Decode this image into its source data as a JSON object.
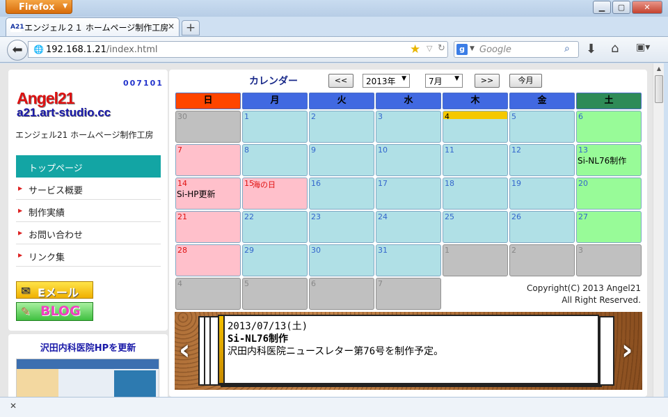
{
  "browser": {
    "app_button": "Firefox",
    "tab_title": "エンジェル２１ ホームページ制作工房",
    "tab_icon_text": "A21",
    "url_host": "192.168.1.21",
    "url_path": "/index.html",
    "search_placeholder": "Google",
    "search_engine_icon": "g-icon"
  },
  "sidebar": {
    "counter": "007101",
    "logo_line1": "Angel21",
    "logo_line2": "a21.art-studio.cc",
    "site_name": "エンジェル21 ホームページ制作工房",
    "menu": [
      {
        "label": "トップページ"
      },
      {
        "label": "サービス概要"
      },
      {
        "label": "制作実績"
      },
      {
        "label": "お問い合わせ"
      },
      {
        "label": "リンク集"
      }
    ],
    "email_label": "Eメール",
    "blog_label": "BLOG",
    "news_title": "沢田内科医院HPを更新"
  },
  "calendar": {
    "title": "カレンダー",
    "prev_label": "<<",
    "next_label": ">>",
    "year": "2013年",
    "month": "7月",
    "today_label": "今月",
    "weekdays": [
      "日",
      "月",
      "火",
      "水",
      "木",
      "金",
      "土"
    ],
    "weekday_colors": [
      "#ff4500",
      "#4169e1",
      "#4169e1",
      "#4169e1",
      "#4169e1",
      "#4169e1",
      "#2e8b57"
    ],
    "rows": [
      [
        {
          "d": "30",
          "t": "other"
        },
        {
          "d": "1",
          "t": "weekday"
        },
        {
          "d": "2",
          "t": "weekday"
        },
        {
          "d": "3",
          "t": "weekday"
        },
        {
          "d": "4",
          "t": "today"
        },
        {
          "d": "5",
          "t": "weekday"
        },
        {
          "d": "6",
          "t": "sat"
        }
      ],
      [
        {
          "d": "7",
          "t": "sun"
        },
        {
          "d": "8",
          "t": "weekday"
        },
        {
          "d": "9",
          "t": "weekday"
        },
        {
          "d": "10",
          "t": "weekday"
        },
        {
          "d": "11",
          "t": "weekday"
        },
        {
          "d": "12",
          "t": "weekday"
        },
        {
          "d": "13",
          "t": "sat",
          "ev": "Si-NL76制作"
        }
      ],
      [
        {
          "d": "14",
          "t": "sun",
          "ev": "Si-HP更新"
        },
        {
          "d": "15",
          "t": "sun",
          "hol": "海の日"
        },
        {
          "d": "16",
          "t": "weekday"
        },
        {
          "d": "17",
          "t": "weekday"
        },
        {
          "d": "18",
          "t": "weekday"
        },
        {
          "d": "19",
          "t": "weekday"
        },
        {
          "d": "20",
          "t": "sat"
        }
      ],
      [
        {
          "d": "21",
          "t": "sun"
        },
        {
          "d": "22",
          "t": "weekday"
        },
        {
          "d": "23",
          "t": "weekday"
        },
        {
          "d": "24",
          "t": "weekday"
        },
        {
          "d": "25",
          "t": "weekday"
        },
        {
          "d": "26",
          "t": "weekday"
        },
        {
          "d": "27",
          "t": "sat"
        }
      ],
      [
        {
          "d": "28",
          "t": "sun"
        },
        {
          "d": "29",
          "t": "weekday"
        },
        {
          "d": "30",
          "t": "weekday"
        },
        {
          "d": "31",
          "t": "weekday"
        },
        {
          "d": "1",
          "t": "other"
        },
        {
          "d": "2",
          "t": "other"
        },
        {
          "d": "3",
          "t": "other"
        }
      ],
      [
        {
          "d": "4",
          "t": "other"
        },
        {
          "d": "5",
          "t": "other"
        },
        {
          "d": "6",
          "t": "other"
        },
        {
          "d": "7",
          "t": "other"
        }
      ]
    ],
    "copyright_line1": "Copyright(C) 2013 Angel21",
    "copyright_line2": "All Right Reserved."
  },
  "board": {
    "date": "2013/07/13(土)",
    "subject": "Si-NL76制作",
    "body": "沢田内科医院ニュースレター第76号を制作予定。"
  }
}
